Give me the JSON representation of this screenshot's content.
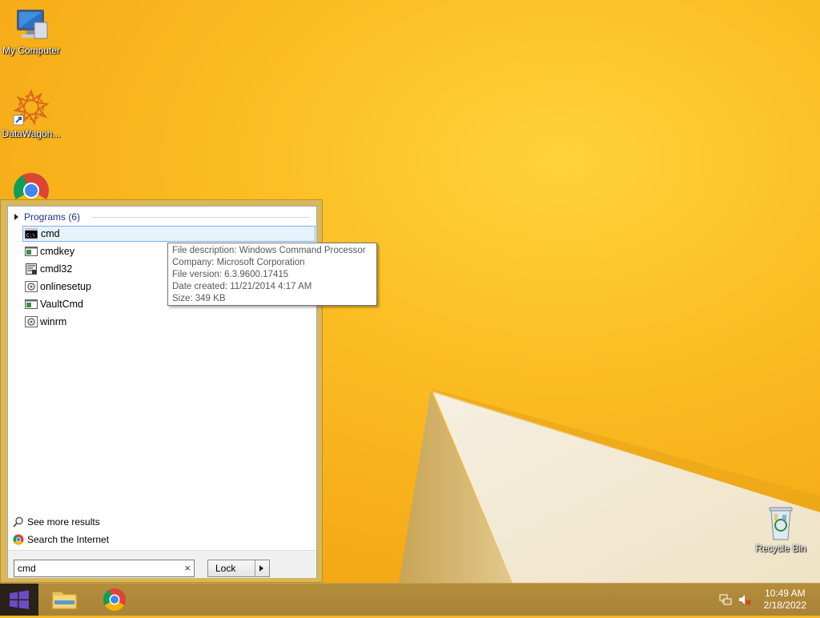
{
  "desktop": {
    "icons": [
      {
        "label": "My Computer",
        "icon": "computer-icon"
      },
      {
        "label": "DataWagon...",
        "icon": "datawagon-icon"
      },
      {
        "label": "",
        "icon": "chrome-icon"
      },
      {
        "label": "Recycle Bin",
        "icon": "recycle-bin-icon"
      }
    ]
  },
  "start_menu": {
    "group_header": "Programs (6)",
    "programs": [
      {
        "name": "cmd",
        "icon": "cmd-icon",
        "selected": true
      },
      {
        "name": "cmdkey",
        "icon": "console-app-icon"
      },
      {
        "name": "cmdl32",
        "icon": "cmdl32-icon"
      },
      {
        "name": "onlinesetup",
        "icon": "gear-app-icon"
      },
      {
        "name": "VaultCmd",
        "icon": "console-app-icon"
      },
      {
        "name": "winrm",
        "icon": "gear-app-icon"
      }
    ],
    "see_more": "See more results",
    "search_internet": "Search the Internet",
    "search_value": "cmd",
    "clear_symbol": "×",
    "lock_label": "Lock"
  },
  "tooltip": {
    "line1": "File description: Windows Command Processor",
    "line2": "Company: Microsoft Corporation",
    "line3": "File version: 6.3.9600.17415",
    "line4": "Date created: 11/21/2014 4:17 AM",
    "line5": "Size: 349 KB"
  },
  "taskbar": {
    "apps": [
      "windows-start-icon",
      "file-explorer-icon",
      "chrome-icon"
    ],
    "tray": [
      "network-icon",
      "volume-muted-icon"
    ],
    "time": "10:49 AM",
    "date": "2/18/2022"
  }
}
